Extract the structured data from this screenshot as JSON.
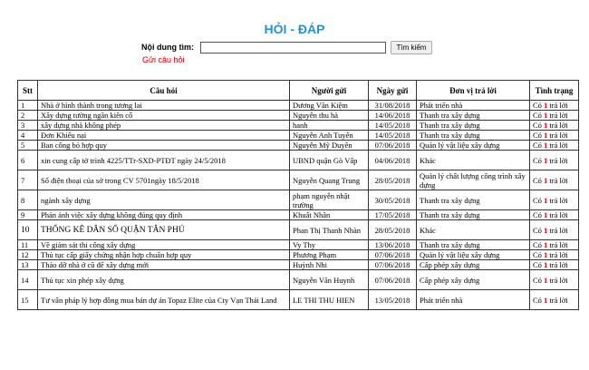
{
  "page": {
    "title": "HỎI - ĐÁP",
    "search_label": "Nội dung tìm:",
    "search_value": "",
    "search_button": "Tìm kiếm",
    "ask_link": "Gửi câu hỏi"
  },
  "table": {
    "headers": {
      "stt": "Stt",
      "question": "Câu hỏi",
      "sender": "Người gửi",
      "date": "Ngày gửi",
      "unit": "Đơn vị trả lời",
      "status": "Tình trạng"
    },
    "rows": [
      {
        "stt": "1",
        "question": "Nhà ở hình thành trong tương lai",
        "sender": "Dương Văn Kiệm",
        "date": "31/08/2018",
        "unit": "Phát triển nhà",
        "status_pre": "Có",
        "status_count": "1",
        "status_post": "trả lời"
      },
      {
        "stt": "2",
        "question": "Xây dựng tường ngăn kiên cố",
        "sender": "Nguyễn thu hà",
        "date": "14/06/2018",
        "unit": "Thanh tra xây dựng",
        "status_pre": "Có",
        "status_count": "1",
        "status_post": "trả lời"
      },
      {
        "stt": "3",
        "question": "xây dựng nhà không phép",
        "sender": "hanh",
        "date": "14/05/2018",
        "unit": "Thanh tra xây dựng",
        "status_pre": "Có",
        "status_count": "1",
        "status_post": "trả lời"
      },
      {
        "stt": "4",
        "question": "Đơn Khiếu nại",
        "sender": "Nguyễn Anh Tuyến",
        "date": "14/05/2018",
        "unit": "Thanh tra xây dựng",
        "status_pre": "Có",
        "status_count": "1",
        "status_post": "trả lời"
      },
      {
        "stt": "5",
        "question": "Ban công bỏ hợp quy",
        "sender": "Nguyễn Mỹ Duyên",
        "date": "07/06/2018",
        "unit": "Quản lý vật liệu xây dựng",
        "status_pre": "Có",
        "status_count": "1",
        "status_post": "trả lời"
      },
      {
        "stt": "6",
        "question": "xin cung cấp tờ trình 4225/TTr-SXD-PTĐT ngày 24/5/2018",
        "sender": "UBND quận Gò Vấp",
        "date": "04/06/2018",
        "unit": "Khác",
        "status_pre": "Có",
        "status_count": "1",
        "status_post": "trả lời"
      },
      {
        "stt": "7",
        "question": "Số điện thoại của sở trong CV 5701ngày 18/5/2018",
        "sender": "Nguyễn Quang Trung",
        "date": "28/05/2018",
        "unit": "Quản lý chất lượng công trình xây dựng",
        "status_pre": "Có",
        "status_count": "1",
        "status_post": "trả lời"
      },
      {
        "stt": "8",
        "question": "ngành xây dựng",
        "sender": "phạm nguyễn nhật trường",
        "date": "30/05/2018",
        "unit": "Thanh tra xây dựng",
        "status_pre": "Có",
        "status_count": "1",
        "status_post": "trả lời"
      },
      {
        "stt": "9",
        "question": "Phản ánh việc xây dựng không đúng quy định",
        "sender": "Khuất Nhân",
        "date": "17/05/2018",
        "unit": "Thanh tra xây dựng",
        "status_pre": "Có",
        "status_count": "1",
        "status_post": "trả lời"
      },
      {
        "stt": "10",
        "question": "THỐNG KÊ DÂN SỐ QUẬN TÂN PHÚ",
        "sender": "Phan Thị Thanh Nhàn",
        "date": "28/05/2018",
        "unit": "Khác",
        "status_pre": "Có",
        "status_count": "1",
        "status_post": "trả lời"
      },
      {
        "stt": "11",
        "question": "Về giám sát thi công xây dựng",
        "sender": "Vy Thy",
        "date": "13/06/2018",
        "unit": "Thanh tra xây dựng",
        "status_pre": "Có",
        "status_count": "1",
        "status_post": "trả lời"
      },
      {
        "stt": "12",
        "question": "Thủ tục cấp giấy chứng nhận hợp chuẩn hợp quy",
        "sender": "Phương Phạm",
        "date": "07/06/2018",
        "unit": "Quản lý vật liệu xây dựng",
        "status_pre": "Có",
        "status_count": "1",
        "status_post": "trả lời"
      },
      {
        "stt": "13",
        "question": "Tháo dỡ nhà ở cũ để xây dựng mới",
        "sender": "Huỳnh Nhi",
        "date": "07/06/2018",
        "unit": "Cấp phép xây dựng",
        "status_pre": "Có",
        "status_count": "1",
        "status_post": "trả lời"
      },
      {
        "stt": "14",
        "question": "Thủ tục xin phép xây dựng",
        "sender": "Nguyễn Văn Huynh",
        "date": "07/06/2018",
        "unit": "Cấp phép xây dựng",
        "status_pre": "Có",
        "status_count": "1",
        "status_post": "trả lời"
      },
      {
        "stt": "15",
        "question": "Tư vấn pháp lý hợp đồng mua bán dự án Topaz Elite của Cty Vạn Thái Land",
        "sender": "LE THI THU HIEN",
        "date": "13/05/2018",
        "unit": "Phát triển nhà",
        "status_pre": "Có",
        "status_count": "1",
        "status_post": "trả lời"
      }
    ]
  }
}
